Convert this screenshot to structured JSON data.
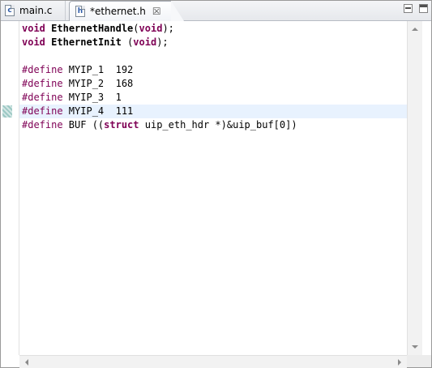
{
  "tabs": [
    {
      "label": "main.c",
      "icon": "c-file-icon",
      "icon_letter": "c",
      "active": false
    },
    {
      "label": "*ethernet.h",
      "icon": "h-file-icon",
      "icon_letter": "h",
      "active": true,
      "close": "☒"
    }
  ],
  "window": {
    "minimize_icon": "minimize-icon",
    "maximize_icon": "maximize-icon"
  },
  "editor": {
    "current_line_index": 6,
    "lines": [
      {
        "tokens": [
          {
            "t": "void",
            "c": "kw"
          },
          {
            "t": " ",
            "c": ""
          },
          {
            "t": "EthernetHandle",
            "c": "fn"
          },
          {
            "t": "(",
            "c": ""
          },
          {
            "t": "void",
            "c": "kw"
          },
          {
            "t": ");",
            "c": ""
          }
        ]
      },
      {
        "tokens": [
          {
            "t": "void",
            "c": "kw"
          },
          {
            "t": " ",
            "c": ""
          },
          {
            "t": "EthernetInit",
            "c": "fn"
          },
          {
            "t": " (",
            "c": ""
          },
          {
            "t": "void",
            "c": "kw"
          },
          {
            "t": ");",
            "c": ""
          }
        ]
      },
      {
        "tokens": []
      },
      {
        "tokens": [
          {
            "t": "#define",
            "c": "pp"
          },
          {
            "t": " MYIP_1  192",
            "c": ""
          }
        ]
      },
      {
        "tokens": [
          {
            "t": "#define",
            "c": "pp"
          },
          {
            "t": " MYIP_2  168",
            "c": ""
          }
        ]
      },
      {
        "tokens": [
          {
            "t": "#define",
            "c": "pp"
          },
          {
            "t": " MYIP_3  1",
            "c": ""
          }
        ]
      },
      {
        "tokens": [
          {
            "t": "#define",
            "c": "pp"
          },
          {
            "t": " MYIP_4  111",
            "c": ""
          }
        ]
      },
      {
        "tokens": [
          {
            "t": "#define",
            "c": "pp"
          },
          {
            "t": " BUF ((",
            "c": ""
          },
          {
            "t": "struct",
            "c": "kw"
          },
          {
            "t": " uip_eth_hdr *)&uip_buf[0])",
            "c": ""
          }
        ]
      }
    ]
  },
  "colors": {
    "keyword": "#7f0055",
    "current_line": "#e8f2fe",
    "change_marker": "#9cc8c4"
  }
}
